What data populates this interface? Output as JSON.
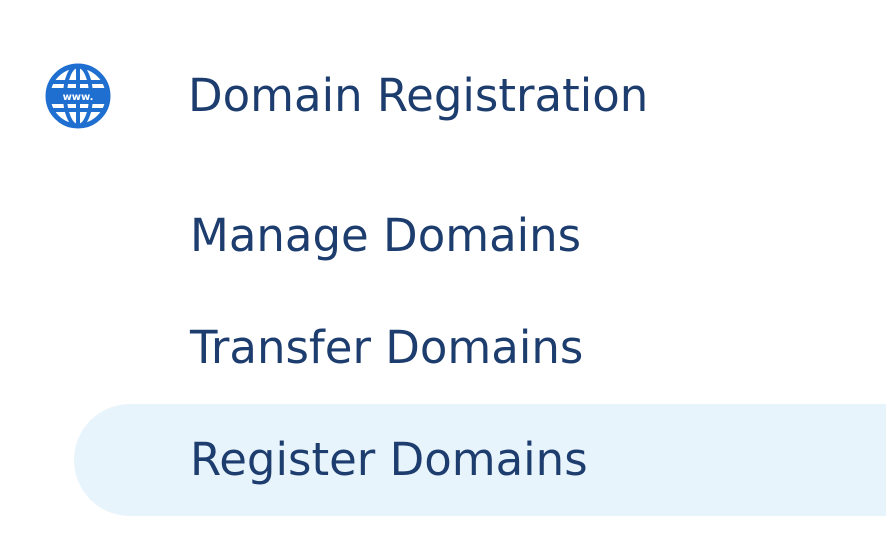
{
  "nav": {
    "section": {
      "title": "Domain Registration",
      "icon": "globe-www-icon",
      "icon_text": "www.",
      "icon_color": "#1f6fd1"
    },
    "items": [
      {
        "label": "Manage Domains",
        "active": false
      },
      {
        "label": "Transfer Domains",
        "active": false
      },
      {
        "label": "Register Domains",
        "active": true
      }
    ]
  },
  "colors": {
    "text": "#1d3d6e",
    "active_background": "#e8f4fb",
    "icon": "#1f6fd1"
  }
}
